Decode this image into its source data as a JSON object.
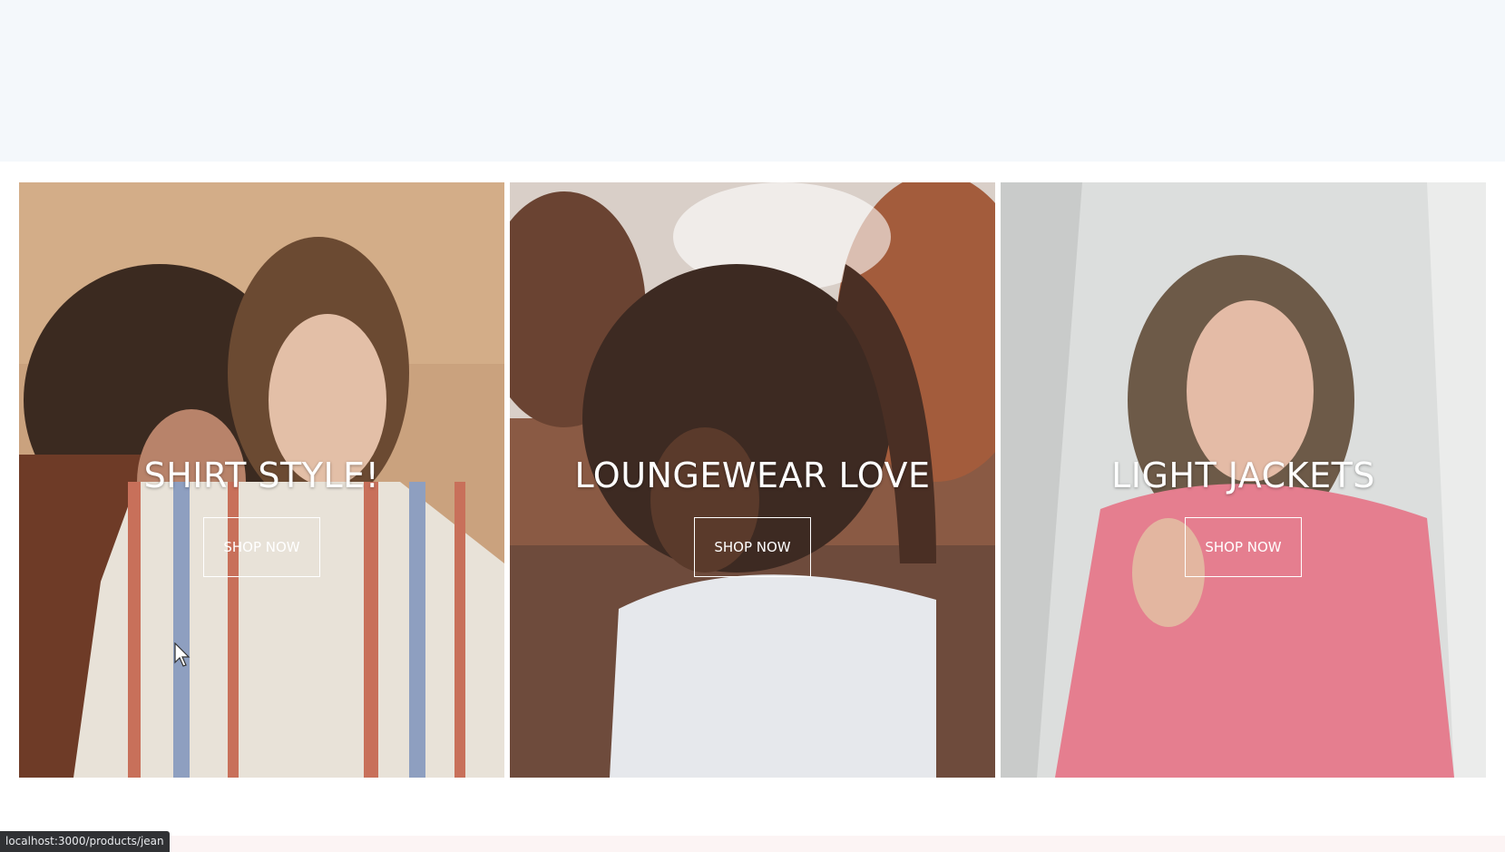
{
  "categories": [
    {
      "title": "SHIRT STYLE!",
      "button_label": "SHOP NOW",
      "image": "two-women-striped-shirt-photo"
    },
    {
      "title": "LOUNGEWEAR LOVE",
      "button_label": "SHOP NOW",
      "image": "woman-white-tee-autumn-photo"
    },
    {
      "title": "LIGHT JACKETS",
      "button_label": "SHOP NOW",
      "image": "woman-pink-jacket-photo"
    }
  ],
  "status_bar": {
    "url": "localhost:3000/products/jean"
  },
  "colors": {
    "top_band": "#f4f8fb",
    "status_bar_bg": "#303134",
    "bottom_strip": "#fcf4f4"
  }
}
